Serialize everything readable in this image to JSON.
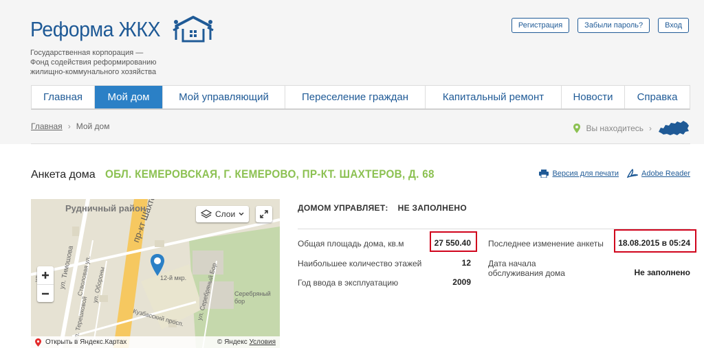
{
  "header": {
    "logo_text": "Реформа ЖКХ",
    "tagline": [
      "Государственная корпорация —",
      "Фонд содействия реформированию",
      "жилищно-коммунального хозяйства"
    ],
    "buttons": {
      "register": "Регистрация",
      "forgot": "Забыли пароль?",
      "login": "Вход"
    }
  },
  "nav": {
    "items": [
      "Главная",
      "Мой дом",
      "Мой управляющий",
      "Переселение граждан",
      "Капитальный ремонт",
      "Новости",
      "Справка"
    ],
    "active_index": 1
  },
  "breadcrumb": {
    "home": "Главная",
    "sep": "›",
    "current": "Мой дом"
  },
  "location": {
    "label": "Вы находитесь",
    "sep": "›"
  },
  "page": {
    "title": "Анкета дома",
    "address": "ОБЛ. КЕМЕРОВСКАЯ, Г. КЕМЕРОВО, ПР-КТ. ШАХТЕРОВ, Д. 68",
    "print_link": "Версия для печати",
    "reader_link": "Adobe Reader"
  },
  "map": {
    "district": "Рудничный район",
    "layers": "Слои",
    "open_in": "Открыть в Яндекс.Картах",
    "copyright": "© Яндекс",
    "terms": "Условия",
    "labels": {
      "prospekt": "пр-кт Шахтеров",
      "mkr": "12-й мкр.",
      "stvolovaya": "Стволовая ул.",
      "oborony": "ул. Обороны",
      "serebryany_bor": "ул. Серебряный Бор",
      "kuzbassky": "Кузбасский просп.",
      "bor": "Серебряный бор",
      "left_street": "ул. Терешковой",
      "left_street2": "ул. Тимошова",
      "left_street3": "ул."
    },
    "colors": {
      "road": "#f6c860",
      "green": "#c5d8ac",
      "bg": "#e6e2d3",
      "marker": "#2b80c6"
    }
  },
  "info": {
    "managed_label": "ДОМОМ УПРАВЛЯЕТ:",
    "managed_value": "НЕ ЗАПОЛНЕНО",
    "area_label": "Общая площадь дома, кв.м",
    "area_value": "27 550.40",
    "floors_label": "Наибольшее количество этажей",
    "floors_value": "12",
    "year_label": "Год ввода в эксплуатацию",
    "year_value": "2009",
    "last_change_label": "Последнее изменение анкеты",
    "last_change_value": "18.08.2015 в 05:24",
    "service_start_label_1": "Дата начала",
    "service_start_label_2": "обслуживания дома",
    "service_start_value": "Не заполнено"
  },
  "colors": {
    "brand": "#1f5a96",
    "accent": "#2b80c6",
    "address": "#8cc152",
    "highlight": "#d0021b"
  }
}
